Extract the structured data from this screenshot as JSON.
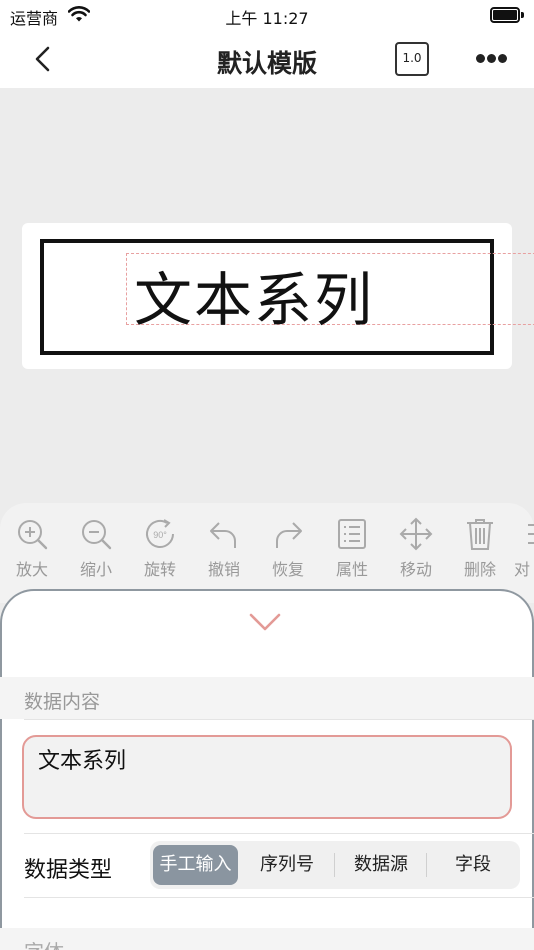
{
  "status_bar": {
    "carrier": "运营商",
    "time": "上午 11:27"
  },
  "nav": {
    "title": "默认模版",
    "scale": "1.0"
  },
  "canvas": {
    "label_text": "文本系列"
  },
  "toolbar": {
    "items": [
      {
        "label": "放大",
        "icon": "zoom-in-icon"
      },
      {
        "label": "缩小",
        "icon": "zoom-out-icon"
      },
      {
        "label": "旋转",
        "icon": "rotate-icon",
        "badge": "90°"
      },
      {
        "label": "撤销",
        "icon": "undo-icon"
      },
      {
        "label": "恢复",
        "icon": "redo-icon"
      },
      {
        "label": "属性",
        "icon": "properties-icon"
      },
      {
        "label": "移动",
        "icon": "move-icon"
      },
      {
        "label": "删除",
        "icon": "delete-icon"
      },
      {
        "label": "对",
        "icon": "align-icon"
      }
    ]
  },
  "panel": {
    "section_title": "数据内容",
    "content_value": "文本系列",
    "data_type_label": "数据类型",
    "data_types": [
      "手工输入",
      "序列号",
      "数据源",
      "字段"
    ],
    "selected_type": "手工输入",
    "font_section": "字体"
  },
  "colors": {
    "accent": "#e39a96",
    "segment_active": "#8a95a0",
    "muted_text": "#999999"
  }
}
